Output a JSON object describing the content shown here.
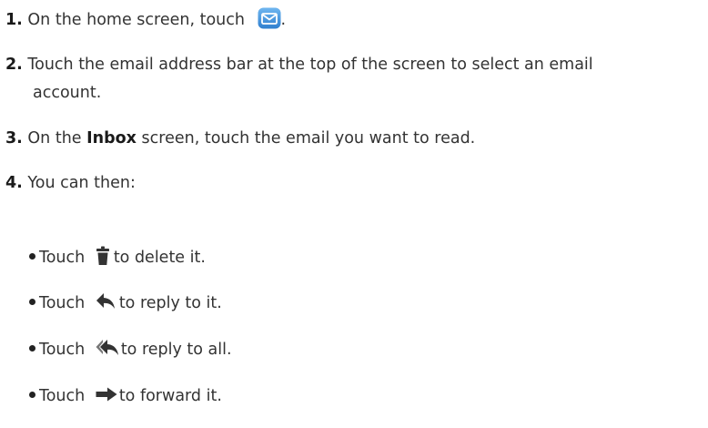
{
  "steps": [
    {
      "number": "1.",
      "text_before": "On the home screen, touch",
      "icon": "email-app-icon",
      "text_after": "."
    },
    {
      "number": "2.",
      "line1": "Touch the email address bar at the top of the screen to select an email",
      "line2": "account."
    },
    {
      "number": "3.",
      "text_before": "On the",
      "bold": "Inbox",
      "text_after": "screen, touch the email you want to read."
    },
    {
      "number": "4.",
      "text": "You can then:"
    }
  ],
  "bullets": [
    {
      "prefix": "Touch",
      "icon": "delete-trash-icon",
      "text": "to delete it."
    },
    {
      "prefix": "Touch",
      "icon": "reply-arrow-icon",
      "text": "to reply to it."
    },
    {
      "prefix": "Touch",
      "icon": "reply-all-arrow-icon",
      "text": "to reply to all."
    },
    {
      "prefix": "Touch",
      "icon": "forward-arrow-icon",
      "text": "to forward it."
    }
  ],
  "colors": {
    "text": "#333333",
    "email_icon_blue": "#3f8fd8",
    "icon_dark": "#333333"
  }
}
